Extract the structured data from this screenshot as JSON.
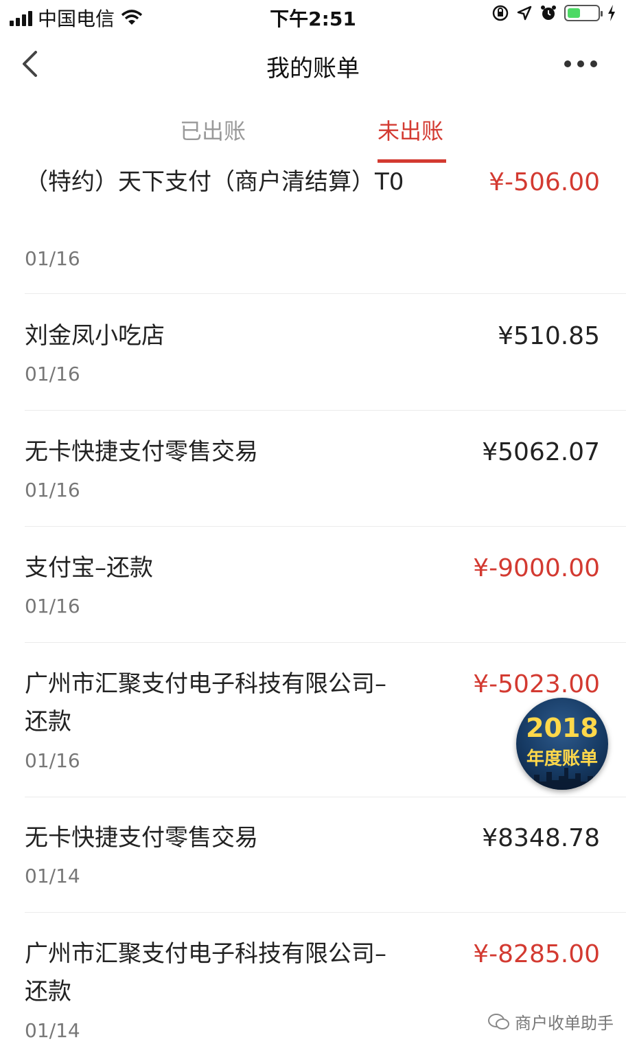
{
  "status_bar": {
    "carrier": "中国电信",
    "time": "下午2:51",
    "icons": [
      "signal-icon",
      "wifi-icon",
      "orientation-lock-icon",
      "location-icon",
      "alarm-icon",
      "battery-icon",
      "charging-icon"
    ]
  },
  "header": {
    "title": "我的账单",
    "back_icon": "chevron-left-icon",
    "more_icon": "more-dots-icon"
  },
  "tabs": [
    {
      "label": "已出账",
      "active": false
    },
    {
      "label": "未出账",
      "active": true
    }
  ],
  "colors": {
    "accent": "#d33a31",
    "negative_amount": "#d33a31",
    "positive_amount": "#222222"
  },
  "transactions": [
    {
      "name": "（特约）天下支付（商户清结算）T0",
      "date": "01/16",
      "amount": "¥-506.00",
      "negative": true
    },
    {
      "name": "刘金凤小吃店",
      "date": "01/16",
      "amount": "¥510.85",
      "negative": false
    },
    {
      "name": "无卡快捷支付零售交易",
      "date": "01/16",
      "amount": "¥5062.07",
      "negative": false
    },
    {
      "name": "支付宝–还款",
      "date": "01/16",
      "amount": "¥-9000.00",
      "negative": true
    },
    {
      "name": "广州市汇聚支付电子科技有限公司–还款",
      "date": "01/16",
      "amount": "¥-5023.00",
      "negative": true
    },
    {
      "name": "无卡快捷支付零售交易",
      "date": "01/14",
      "amount": "¥8348.78",
      "negative": false
    },
    {
      "name": "广州市汇聚支付电子科技有限公司–还款",
      "date": "01/14",
      "amount": "¥-8285.00",
      "negative": true
    }
  ],
  "annual_badge": {
    "year": "2018",
    "label": "年度账单"
  },
  "watermark": {
    "text": "商户收单助手",
    "icon": "wechat-icon"
  }
}
